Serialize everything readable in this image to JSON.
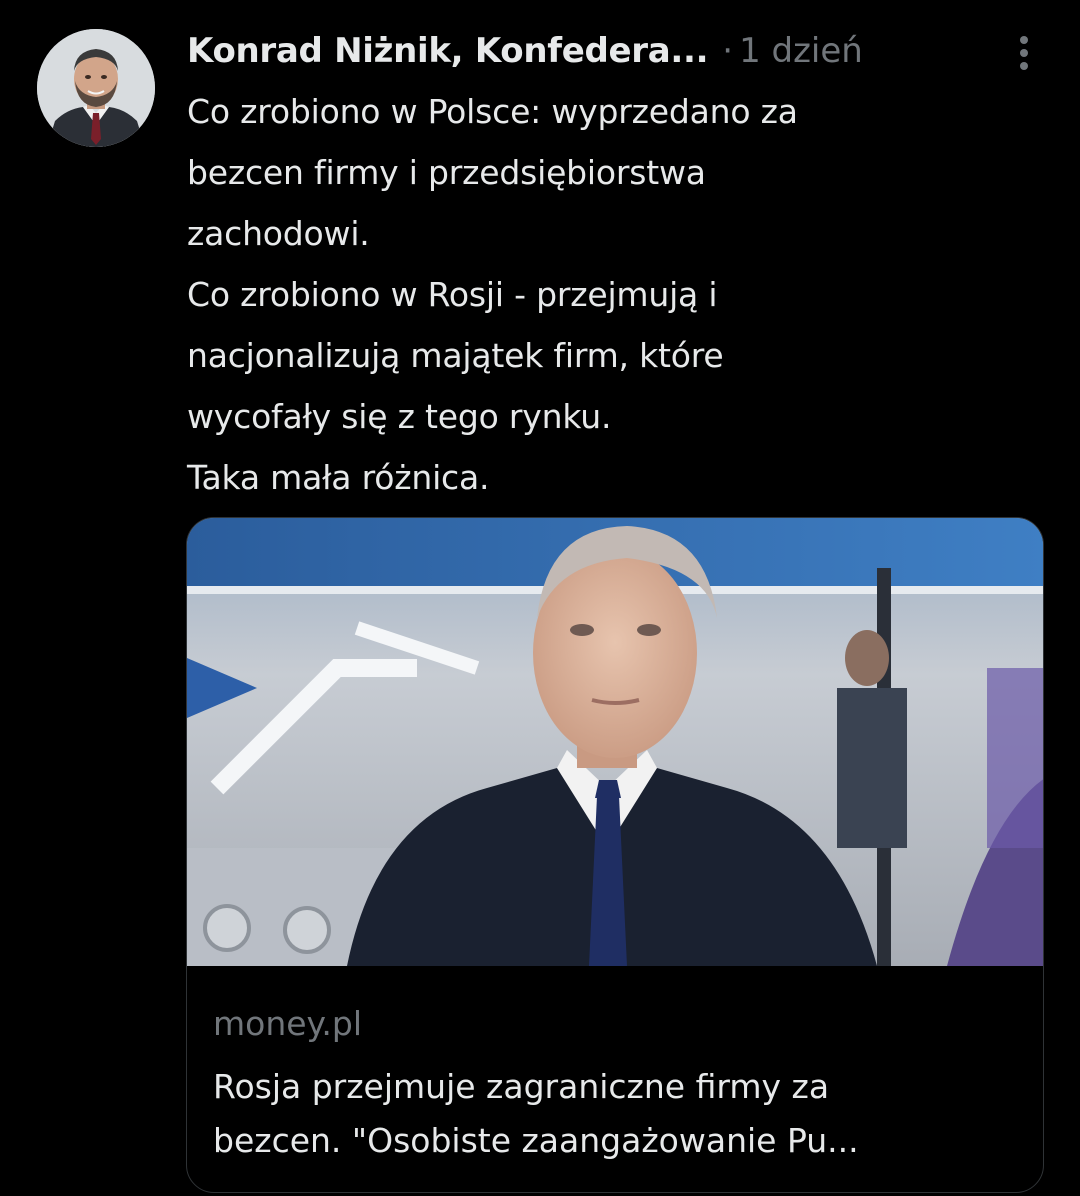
{
  "post": {
    "author_name": "Konrad Niżnik, Konfedera...",
    "separator": "·",
    "timestamp": "1 dzień",
    "text_lines": [
      "Co zrobiono w Polsce: wyprzedano za",
      "bezcen firmy i przedsiębiorstwa",
      "zachodowi.",
      "Co zrobiono w Rosji - przejmują i",
      "nacjonalizują majątek firm, które",
      "wycofały się z tego rynku.",
      "Taka mała różnica."
    ],
    "more_icon": "more-vertical-icon"
  },
  "link_card": {
    "domain": "money.pl",
    "title_lines": [
      "Rosja przejmuje zagraniczne firmy za",
      "bezcen. \"Osobiste zaangażowanie Pu..."
    ]
  },
  "colors": {
    "background": "#000000",
    "primary_text": "#e7e9ea",
    "secondary_text": "#71767b",
    "border": "#2f3336"
  }
}
